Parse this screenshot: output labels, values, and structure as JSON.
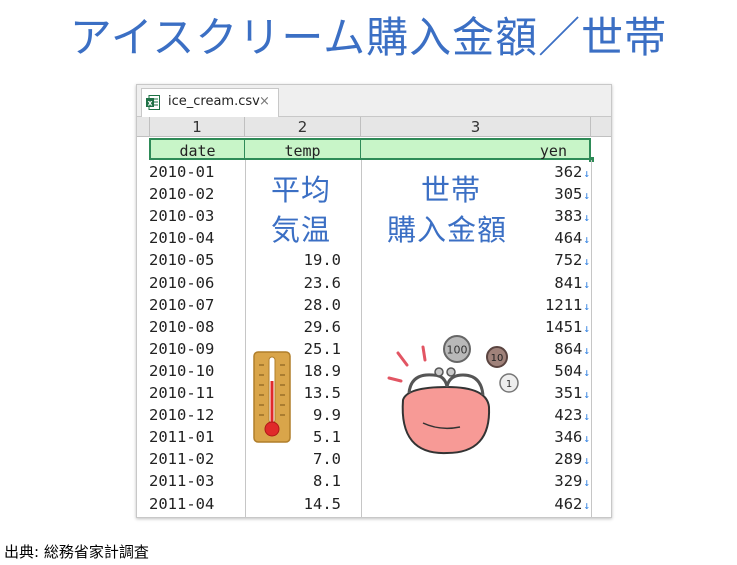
{
  "title": "アイスクリーム購入金額／世帯",
  "source": "出典: 総務省家計調査",
  "editor": {
    "tab": {
      "filename": "ice_cream.csv",
      "close": "×",
      "icon": "excel-icon"
    },
    "column_numbers": [
      "1",
      "2",
      "3"
    ],
    "headers": [
      "date",
      "temp",
      "yen"
    ],
    "rows": [
      {
        "date": "2010-01",
        "temp": "",
        "yen": "362"
      },
      {
        "date": "2010-02",
        "temp": "",
        "yen": "305"
      },
      {
        "date": "2010-03",
        "temp": "",
        "yen": "383"
      },
      {
        "date": "2010-04",
        "temp": "",
        "yen": "464"
      },
      {
        "date": "2010-05",
        "temp": "19.0",
        "yen": "752"
      },
      {
        "date": "2010-06",
        "temp": "23.6",
        "yen": "841"
      },
      {
        "date": "2010-07",
        "temp": "28.0",
        "yen": "1211"
      },
      {
        "date": "2010-08",
        "temp": "29.6",
        "yen": "1451"
      },
      {
        "date": "2010-09",
        "temp": "25.1",
        "yen": "864"
      },
      {
        "date": "2010-10",
        "temp": "18.9",
        "yen": "504"
      },
      {
        "date": "2010-11",
        "temp": "13.5",
        "yen": "351"
      },
      {
        "date": "2010-12",
        "temp": "9.9",
        "yen": "423"
      },
      {
        "date": "2011-01",
        "temp": "5.1",
        "yen": "346"
      },
      {
        "date": "2011-02",
        "temp": "7.0",
        "yen": "289"
      },
      {
        "date": "2011-03",
        "temp": "8.1",
        "yen": "329"
      },
      {
        "date": "2011-04",
        "temp": "14.5",
        "yen": "462"
      }
    ],
    "arrow_glyph": "↓"
  },
  "annotations": {
    "temp_line1": "平均",
    "temp_line2": "気温",
    "yen_line1": "世帯",
    "yen_line2": "購入金額"
  },
  "coins": [
    "100",
    "10",
    "1"
  ],
  "colors": {
    "accent_blue": "#3b6fc4",
    "header_green": "#c8f5c8",
    "header_border": "#2e8b57"
  }
}
